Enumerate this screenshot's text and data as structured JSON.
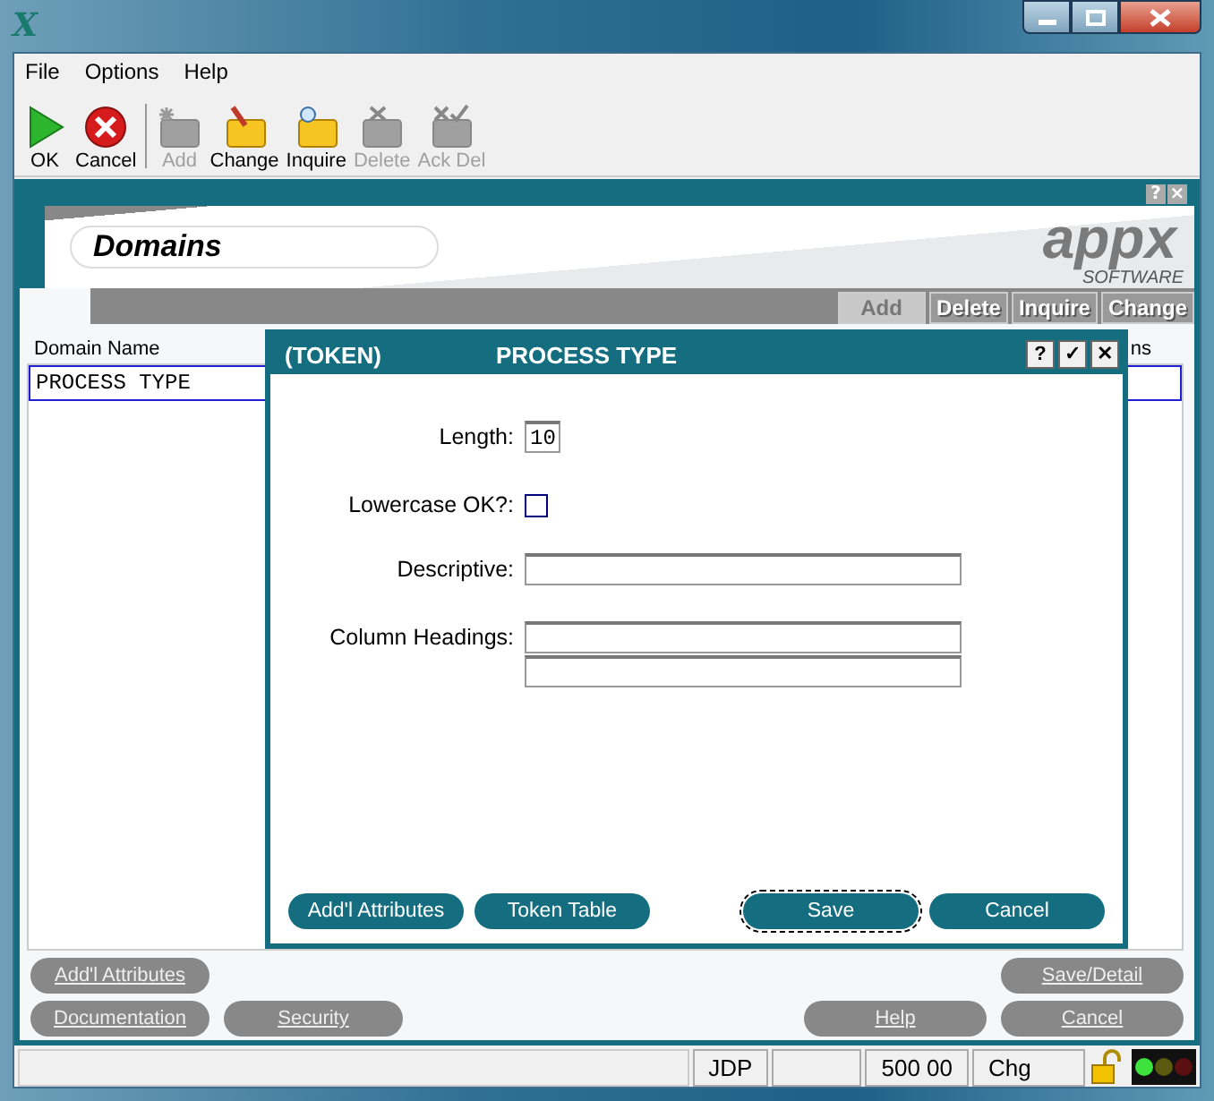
{
  "window": {
    "title_icon": "X"
  },
  "menu": [
    "File",
    "Options",
    "Help"
  ],
  "toolbar": [
    {
      "label": "OK",
      "kind": "ok",
      "disabled": false
    },
    {
      "label": "Cancel",
      "kind": "cancel",
      "disabled": false
    },
    {
      "label": "Add",
      "kind": "add",
      "disabled": true
    },
    {
      "label": "Change",
      "kind": "change",
      "disabled": false
    },
    {
      "label": "Inquire",
      "kind": "inquire",
      "disabled": false
    },
    {
      "label": "Delete",
      "kind": "delete",
      "disabled": true
    },
    {
      "label": "Ack Del",
      "kind": "ackdel",
      "disabled": true
    }
  ],
  "screen": {
    "mini_controls": [
      "?",
      "×"
    ],
    "title": "Domains",
    "logo": "appx",
    "logo_sub": "SOFTWARE",
    "actions": [
      {
        "label": "Add",
        "disabled": true
      },
      {
        "label": "Delete",
        "disabled": false
      },
      {
        "label": "Inquire",
        "disabled": false
      },
      {
        "label": "Change",
        "disabled": false
      }
    ],
    "columns": [
      "Domain Name",
      "ns"
    ],
    "rows": [
      {
        "name": "PROCESS TYPE",
        "selected": true
      }
    ],
    "buttons_left": [
      [
        "Add'l Attributes"
      ],
      [
        "Documentation",
        "Security"
      ]
    ],
    "buttons_right": [
      [
        "Save/Detail"
      ],
      [
        "Help",
        "Cancel"
      ]
    ]
  },
  "dialog": {
    "type": "(TOKEN)",
    "title": "PROCESS TYPE",
    "controls": [
      "?",
      "✓",
      "✕"
    ],
    "fields": [
      {
        "label": "Length:",
        "kind": "short",
        "value": "10"
      },
      {
        "label": "Lowercase OK?:",
        "kind": "checkbox",
        "checked": false
      },
      {
        "label": "Descriptive:",
        "kind": "text"
      },
      {
        "label": "Column Headings:",
        "kind": "text2"
      }
    ],
    "buttons_left": [
      "Add'l Attributes",
      "Token Table"
    ],
    "buttons_right": [
      "Save",
      "Cancel"
    ]
  },
  "status_bar": [
    "JDP",
    "500 00",
    "Chg"
  ]
}
